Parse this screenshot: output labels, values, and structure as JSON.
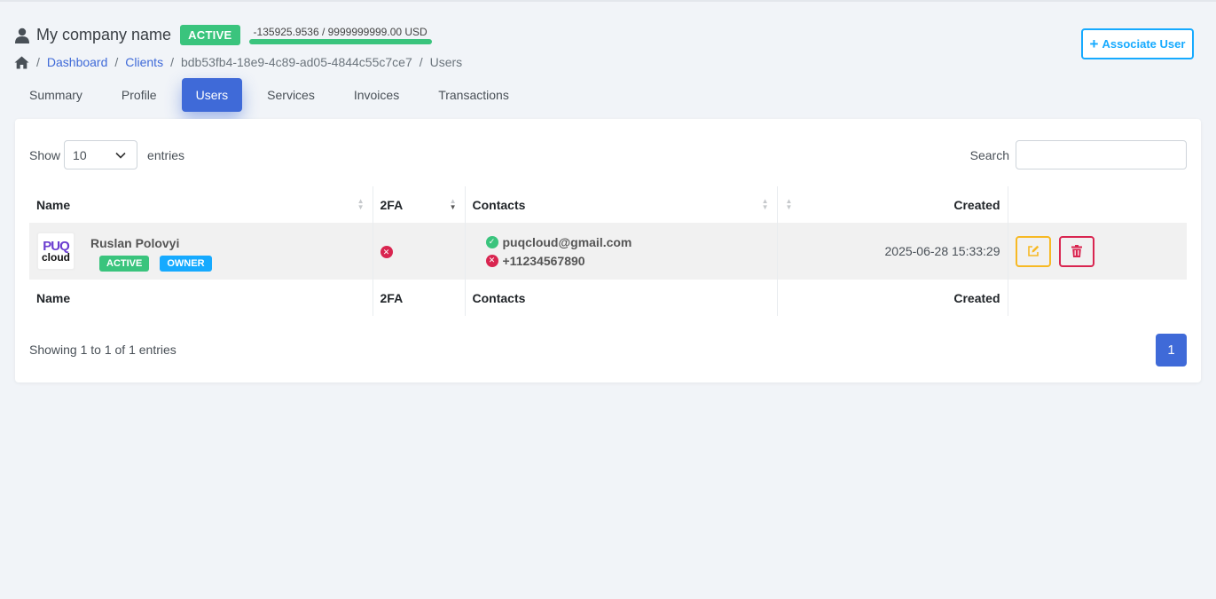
{
  "header": {
    "company_name": "My company name",
    "status": "ACTIVE",
    "balance": "-135925.9536 / 9999999999.00 USD"
  },
  "breadcrumb": {
    "dashboard": "Dashboard",
    "clients": "Clients",
    "client_id": "bdb53fb4-18e9-4c89-ad05-4844c55c7ce7",
    "current": "Users"
  },
  "actions": {
    "associate_user_label": "Associate User"
  },
  "tabs": [
    {
      "label": "Summary"
    },
    {
      "label": "Profile"
    },
    {
      "label": "Users",
      "active": true
    },
    {
      "label": "Services"
    },
    {
      "label": "Invoices"
    },
    {
      "label": "Transactions"
    }
  ],
  "table_controls": {
    "show_label": "Show",
    "entries_value": "10",
    "entries_label": "entries",
    "search_label": "Search",
    "search_value": ""
  },
  "columns": {
    "name": "Name",
    "twofa": "2FA",
    "contacts": "Contacts",
    "created": "Created"
  },
  "rows": [
    {
      "avatar_top": "PUQ",
      "avatar_bottom": "cloud",
      "name": "Ruslan Polovyi",
      "badges": [
        "ACTIVE",
        "OWNER"
      ],
      "twofa_status": "disabled",
      "email": "puqcloud@gmail.com",
      "email_verified": true,
      "phone": "+11234567890",
      "phone_verified": false,
      "created": "2025-06-28 15:33:29"
    }
  ],
  "footer": {
    "showing": "Showing 1 to 1 of 1 entries",
    "page": "1"
  },
  "colors": {
    "primary": "#3f6ad8",
    "success": "#3ac47d",
    "info": "#16aaff",
    "warning": "#f7b924",
    "danger": "#d92550"
  }
}
